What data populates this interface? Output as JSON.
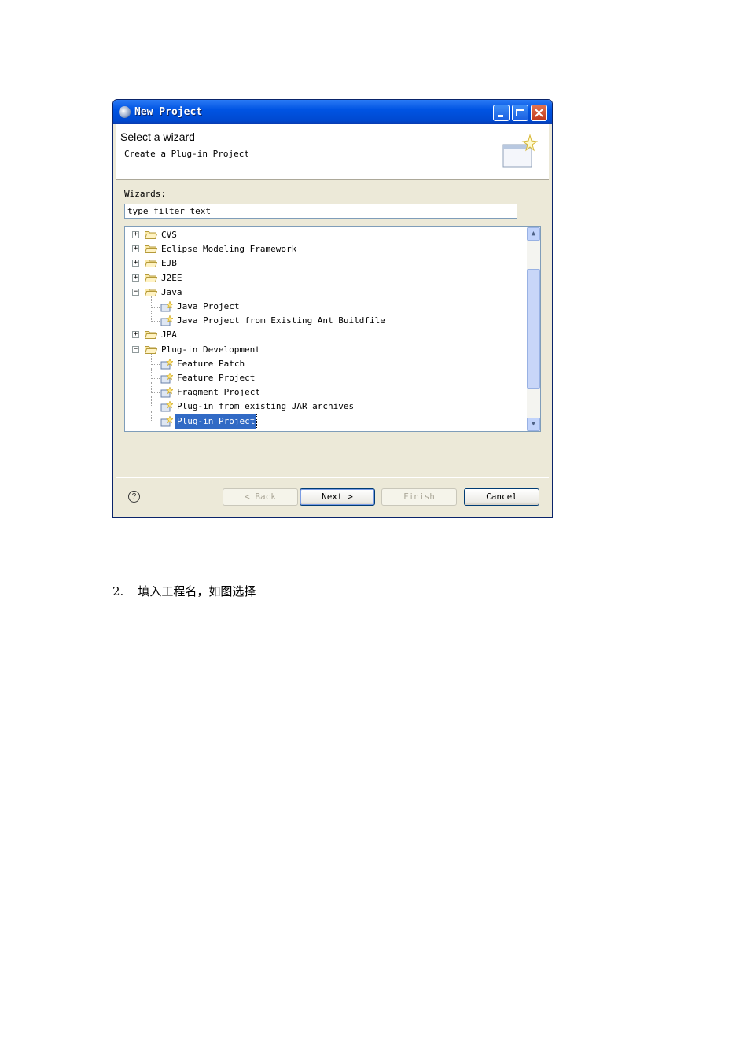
{
  "dialog": {
    "title": "New Project",
    "banner_title": "Select a wizard",
    "banner_subtitle": "Create a Plug-in Project",
    "wizards_label": "Wizards:",
    "filter_value": "type filter text",
    "tree": [
      {
        "label": "CVS",
        "type": "folder",
        "state": "collapsed",
        "level": 0
      },
      {
        "label": "Eclipse Modeling Framework",
        "type": "folder",
        "state": "collapsed",
        "level": 0
      },
      {
        "label": "EJB",
        "type": "folder",
        "state": "collapsed",
        "level": 0
      },
      {
        "label": "J2EE",
        "type": "folder",
        "state": "collapsed",
        "level": 0
      },
      {
        "label": "Java",
        "type": "folder",
        "state": "expanded",
        "level": 0
      },
      {
        "label": "Java Project",
        "type": "wizard",
        "level": 1
      },
      {
        "label": "Java Project from Existing Ant Buildfile",
        "type": "wizard",
        "level": 1
      },
      {
        "label": "JPA",
        "type": "folder",
        "state": "collapsed",
        "level": 0
      },
      {
        "label": "Plug-in Development",
        "type": "folder",
        "state": "expanded",
        "level": 0
      },
      {
        "label": "Feature Patch",
        "type": "wizard",
        "level": 1
      },
      {
        "label": "Feature Project",
        "type": "wizard",
        "level": 1
      },
      {
        "label": "Fragment Project",
        "type": "wizard",
        "level": 1
      },
      {
        "label": "Plug-in from existing JAR archives",
        "type": "wizard",
        "level": 1
      },
      {
        "label": "Plug-in Project",
        "type": "wizard",
        "level": 1,
        "selected": true
      }
    ],
    "buttons": {
      "back": "< Back",
      "next": "Next >",
      "finish": "Finish",
      "cancel": "Cancel"
    },
    "help_symbol": "?"
  },
  "caption": {
    "number": "2.",
    "text": "填入工程名，如图选择"
  }
}
